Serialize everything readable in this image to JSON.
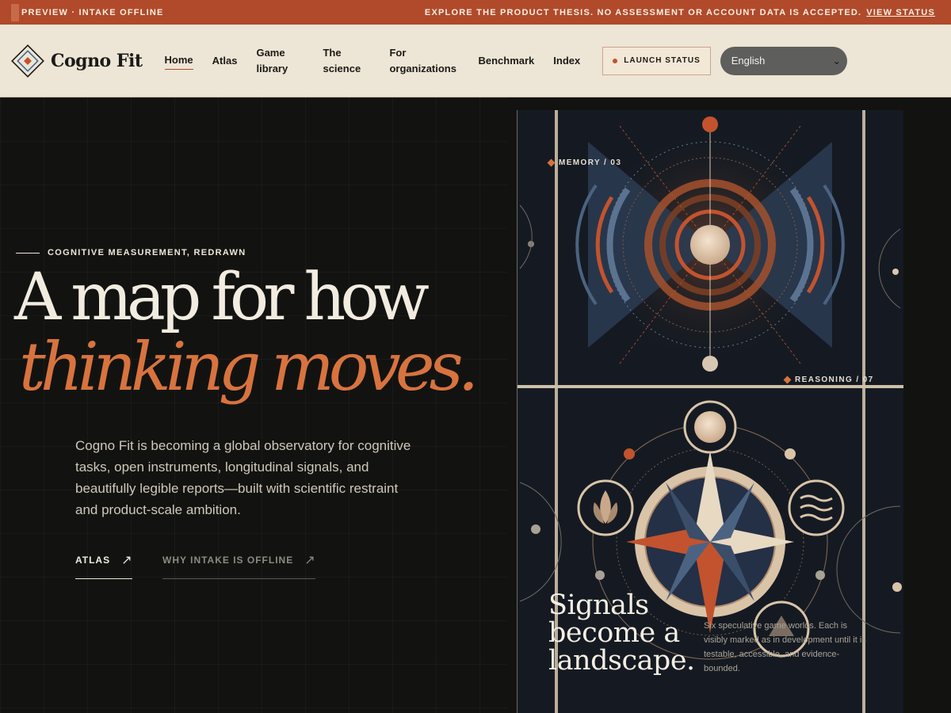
{
  "banner": {
    "left_text": "PREVIEW · INTAKE OFFLINE",
    "right_text": "EXPLORE THE PRODUCT THESIS. NO ASSESSMENT OR ACCOUNT DATA IS ACCEPTED.",
    "status_link": "VIEW STATUS"
  },
  "nav": {
    "brand": "Cogno Fit",
    "items": [
      {
        "label": "Home",
        "active": true
      },
      {
        "label": "Atlas"
      },
      {
        "label": "Game library"
      },
      {
        "label": "The science"
      },
      {
        "label": "For organizations"
      },
      {
        "label": "Benchmark"
      },
      {
        "label": "Index"
      }
    ],
    "launch_status": "LAUNCH STATUS",
    "language": "English"
  },
  "hero": {
    "eyebrow": "COGNITIVE MEASUREMENT, REDRAWN",
    "headline_1": "A map for how",
    "headline_2": "thinking moves.",
    "lead": "Cogno Fit is becoming a global observatory for cognitive tasks, open instruments, longitudinal signals, and beautifully legible reports—built with scientific restraint and product-scale ambition.",
    "cta_primary": "ATLAS",
    "cta_secondary": "WHY INTAKE IS OFFLINE"
  },
  "art": {
    "tag_memory": "MEMORY / 03",
    "tag_reasoning": "REASONING / 07",
    "title": "Signals become a landscape.",
    "description": "Six speculative game worlds. Each is visibly marked as in development until it is testable, accessible, and evidence-bounded."
  },
  "colors": {
    "accent": "#b04a2a",
    "orange": "#d8733f",
    "cream": "#ede5d5",
    "dark": "#121311"
  }
}
